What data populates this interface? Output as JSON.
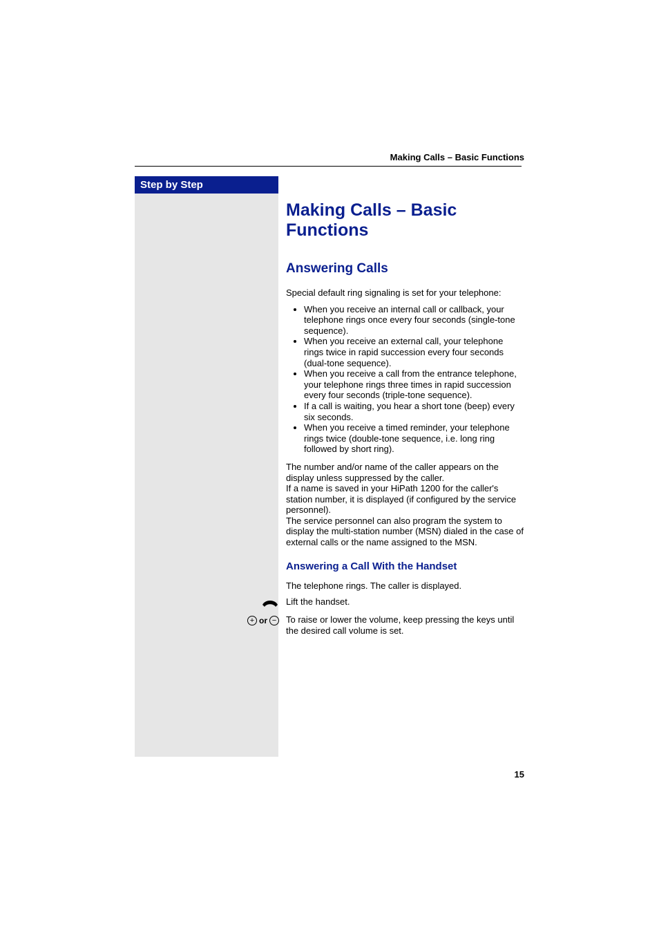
{
  "running_header": "Making Calls – Basic Functions",
  "sidebar": {
    "title": "Step by Step"
  },
  "headings": {
    "h1": "Making Calls – Basic Functions",
    "h2": "Answering Calls",
    "h3": "Answering a Call With the Handset"
  },
  "intro": "Special default ring signaling is set for your telephone:",
  "bullets": [
    "When you receive an internal call or callback, your telephone rings once every four seconds (single-tone sequence).",
    "When you receive an external call, your telephone rings twice in rapid succession every four seconds (dual-tone sequence).",
    "When you receive a call from the entrance telephone, your telephone rings three times in rapid succession every four seconds (triple-tone sequence).",
    "If a call is waiting, you hear a short tone (beep) every six seconds.",
    "When you receive a timed reminder, your telephone rings twice (double-tone sequence, i.e. long ring followed by short ring)."
  ],
  "para_after_bullets": "The number and/or name of the caller appears on the display unless suppressed by the caller.\nIf a name is saved in your HiPath 1200 for the caller's station number, it is displayed (if configured by the service personnel).\nThe service personnel can also program the system to display the multi-station number (MSN) dialed in the case of external calls or the name assigned to the MSN.",
  "ring_line": "The telephone rings. The caller is displayed.",
  "steps": {
    "lift": "Lift the handset.",
    "volume": "To raise or lower the volume, keep pressing the keys until the desired call volume is set.",
    "or": "or"
  },
  "icons": {
    "handset": "handset-icon",
    "plus": "+",
    "minus": "−"
  },
  "page_number": "15"
}
